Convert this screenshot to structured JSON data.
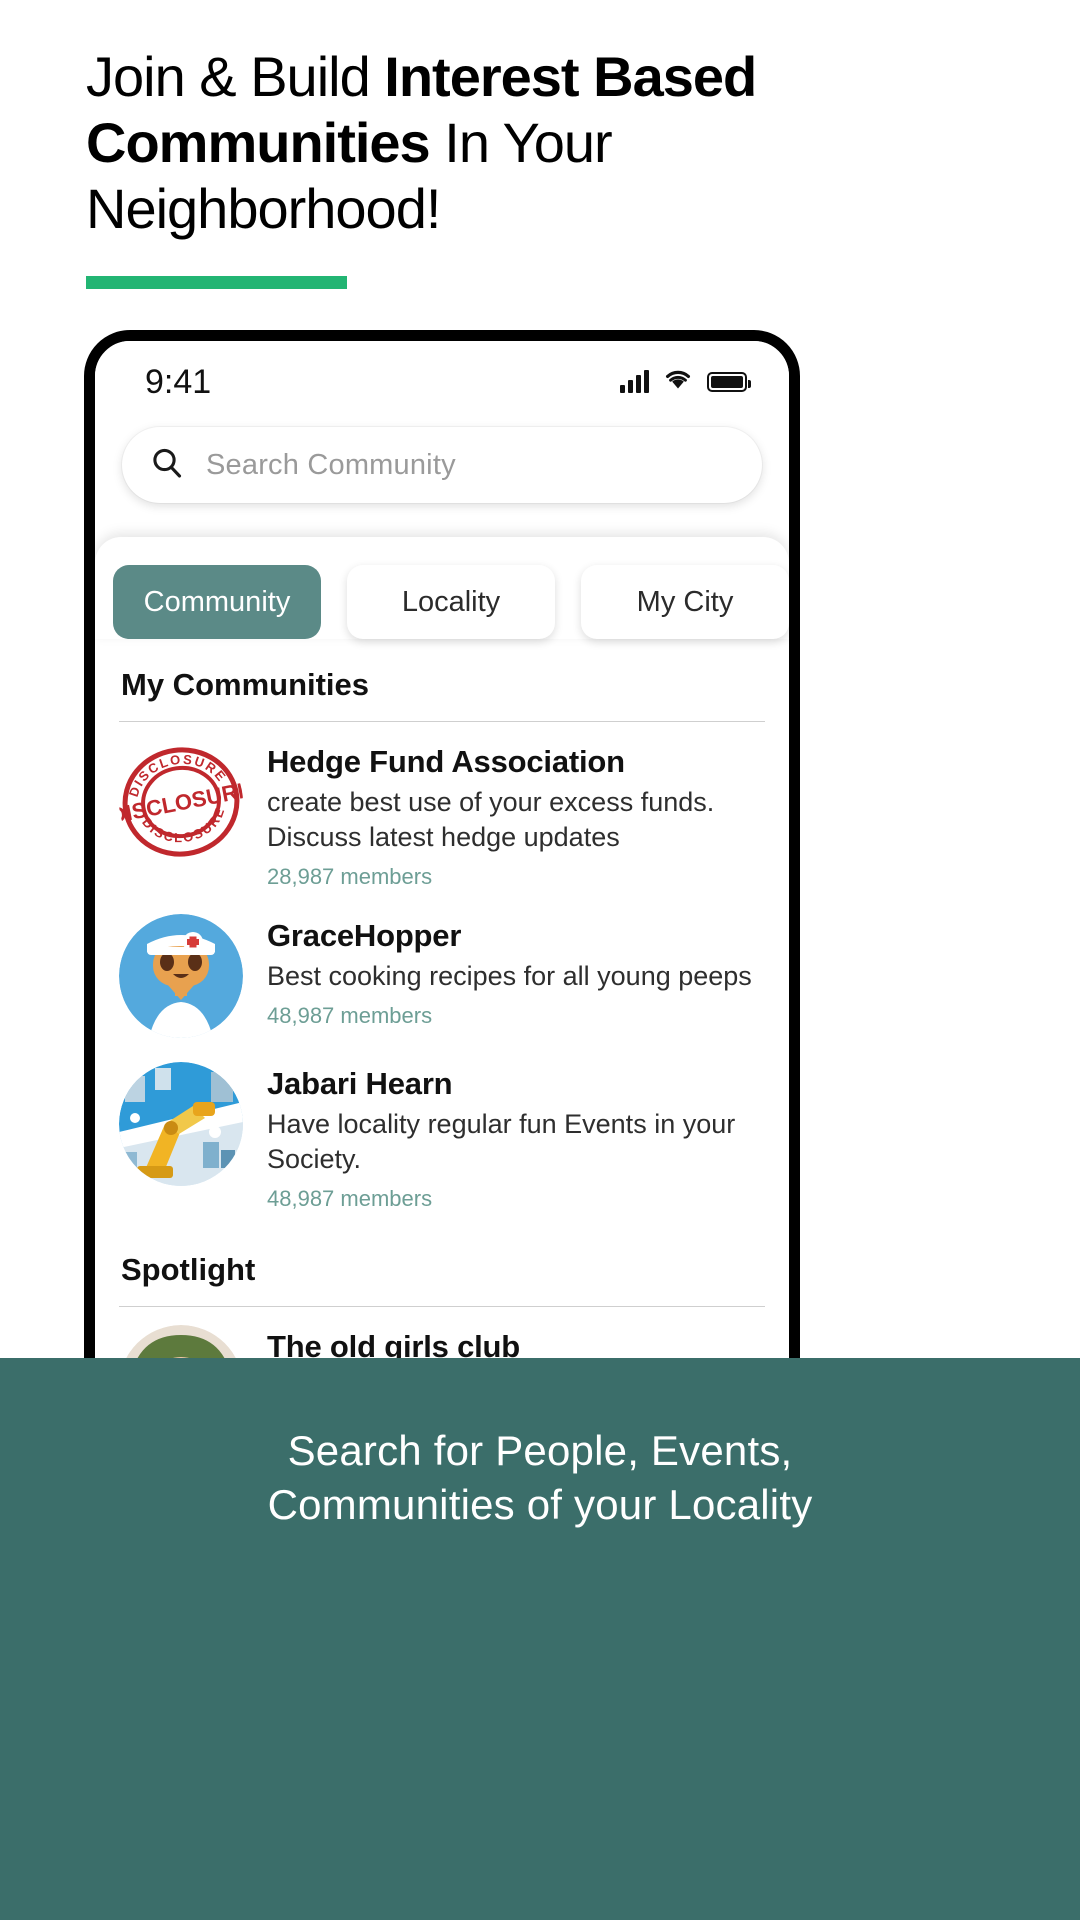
{
  "hero": {
    "line1_regular": "Join & Build ",
    "line1_bold": "Interest Based",
    "line2_bold": "Communities",
    "line2_regular": " In Your",
    "line3_regular": "Neighborhood!",
    "accent_color": "#22b573"
  },
  "phone": {
    "status": {
      "time": "9:41",
      "signal_icon": "cellular-signal-icon",
      "wifi_icon": "wifi-icon",
      "battery_icon": "battery-full-icon"
    },
    "search": {
      "placeholder": "Search Community",
      "icon": "search-icon",
      "value": ""
    },
    "tabs": [
      {
        "label": "Community",
        "active": true
      },
      {
        "label": "Locality",
        "active": false
      },
      {
        "label": "My City",
        "active": false
      }
    ],
    "sections": [
      {
        "title": "My Communities",
        "items": [
          {
            "name": "Hedge Fund Association",
            "description": "create best use of your excess funds. Discuss latest hedge updates",
            "members": "28,987 members",
            "avatar": "disclosure-stamp-avatar"
          },
          {
            "name": "GraceHopper",
            "description": "Best cooking recipes for all young peeps",
            "members": "48,987 members",
            "avatar": "nurse-character-avatar"
          },
          {
            "name": "Jabari Hearn",
            "description": "Have locality regular fun Events in your Society.",
            "members": "48,987 members",
            "avatar": "robot-factory-avatar"
          }
        ]
      },
      {
        "title": "Spotlight",
        "items": [
          {
            "name": "The old girls club",
            "description": "",
            "members": "",
            "avatar": "woman-photo-avatar"
          }
        ]
      }
    ],
    "accent_active_tab": "#5b8a87",
    "members_text_color": "#6d9e95"
  },
  "footer": {
    "caption_line1": "Search for People, Events,",
    "caption_line2": "Communities of your Locality",
    "background": "#3b6e6a"
  }
}
